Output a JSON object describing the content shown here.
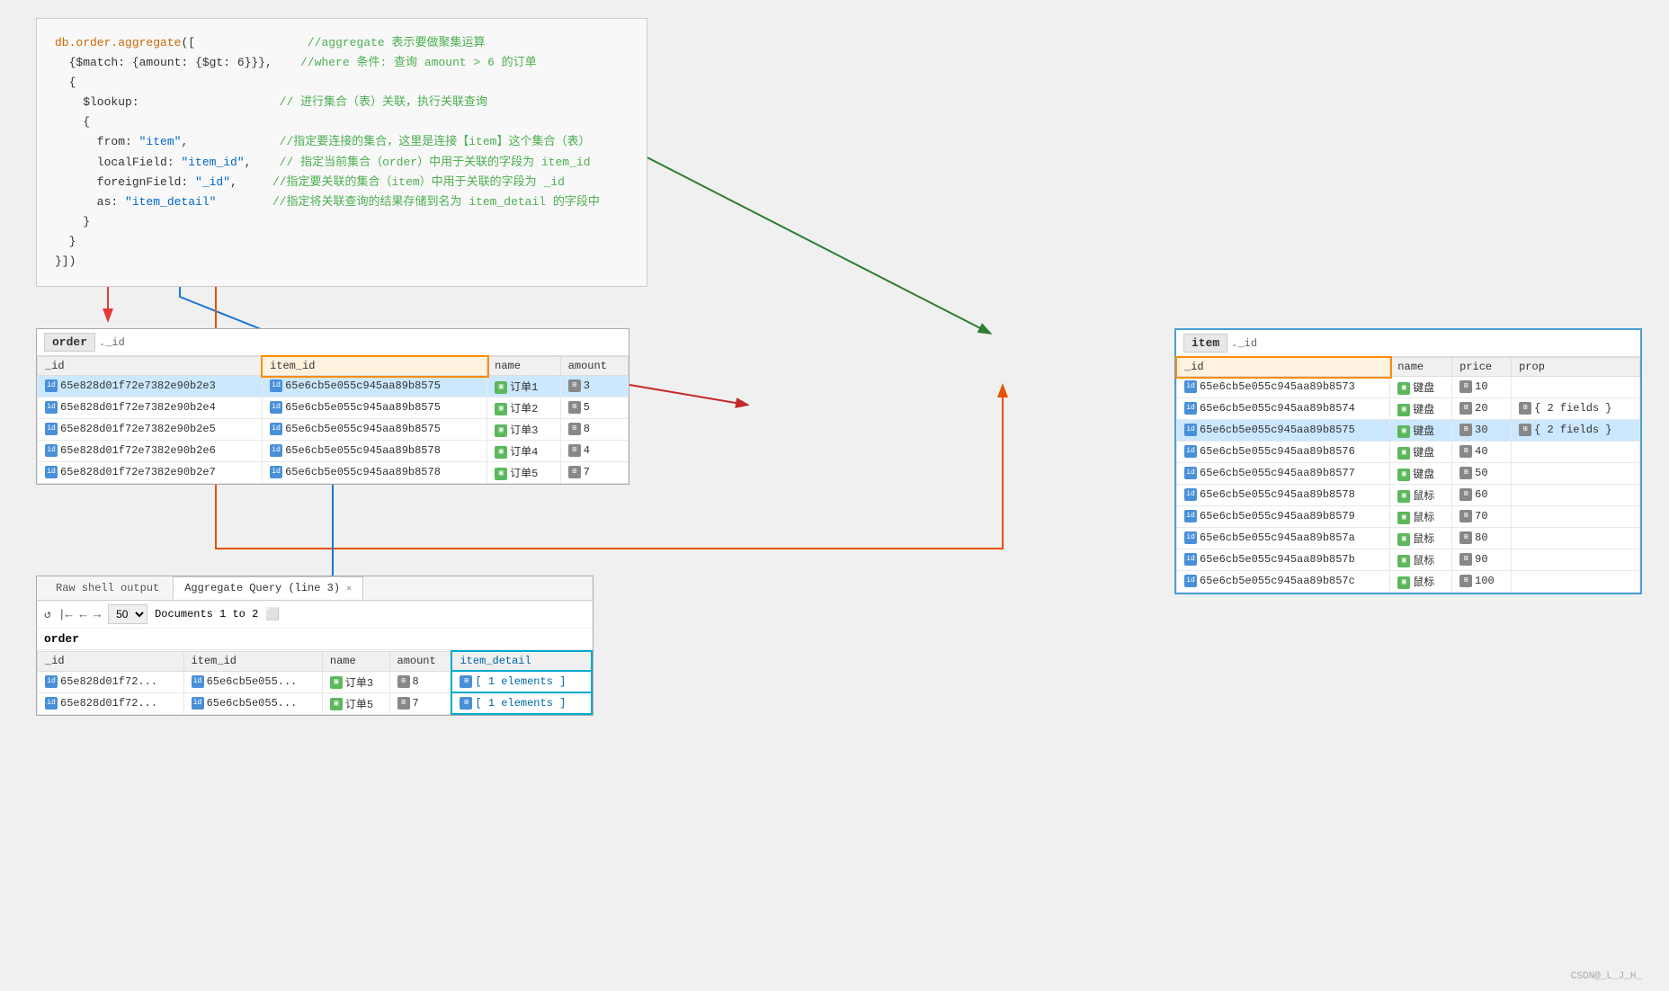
{
  "code": {
    "lines": [
      {
        "text": "db.order.aggregate([",
        "comment": ""
      },
      {
        "text": "  {$match: {amount: {$gt: 6}}},",
        "comment": "  //where 条件: 查询 amount > 6 的订单"
      },
      {
        "text": "  {",
        "comment": ""
      },
      {
        "text": "    $lookup:",
        "comment": "  // 进行集合（表）关联，执行关联查询"
      },
      {
        "text": "    {",
        "comment": ""
      },
      {
        "text": "      from: \"item\",",
        "comment": "      //指定要连接的集合，这里是连接【item】这个集合（表）"
      },
      {
        "text": "      localField: \"item_id\",",
        "comment": "      // 指定当前集合（order）中用于关联的字段为 item_id"
      },
      {
        "text": "      foreignField: \"_id\",",
        "comment": "      //指定要关联的集合（item）中用于关联的字段为 _id"
      },
      {
        "text": "      as: \"item_detail\"",
        "comment": "      //指定将关联查询的结果存储到名为 item_detail 的字段中"
      },
      {
        "text": "    }",
        "comment": ""
      },
      {
        "text": "  }",
        "comment": ""
      },
      {
        "text": "}])",
        "comment": ""
      }
    ]
  },
  "order_table": {
    "title": "order",
    "subtitle": "._id",
    "columns": [
      "_id",
      "item_id",
      "name",
      "amount"
    ],
    "rows": [
      {
        "id": "65e828d01f72e7382e90b2e3",
        "item_id": "65e6cb5e055c945aa89b8575",
        "name": "订单1",
        "amount": "3",
        "highlighted": true
      },
      {
        "id": "65e828d01f72e7382e90b2e4",
        "item_id": "65e6cb5e055c945aa89b8575",
        "name": "订单2",
        "amount": "5",
        "highlighted": false
      },
      {
        "id": "65e828d01f72e7382e90b2e5",
        "item_id": "65e6cb5e055c945aa89b8575",
        "name": "订单3",
        "amount": "8",
        "highlighted": false
      },
      {
        "id": "65e828d01f72e7382e90b2e6",
        "item_id": "65e6cb5e055c945aa89b8578",
        "name": "订单4",
        "amount": "4",
        "highlighted": false
      },
      {
        "id": "65e828d01f72e7382e90b2e7",
        "item_id": "65e6cb5e055c945aa89b8578",
        "name": "订单5",
        "amount": "7",
        "highlighted": false
      }
    ]
  },
  "item_table": {
    "title": "item",
    "subtitle": "._id",
    "columns": [
      "_id",
      "name",
      "price",
      "prop"
    ],
    "rows": [
      {
        "id": "65e6cb5e055c945aa89b8573",
        "name": "键盘",
        "price": "10",
        "prop": ""
      },
      {
        "id": "65e6cb5e055c945aa89b8574",
        "name": "键盘",
        "price": "20",
        "prop": "{ 2 fields }"
      },
      {
        "id": "65e6cb5e055c945aa89b8575",
        "name": "键盘",
        "price": "30",
        "prop": "{ 2 fields }",
        "highlighted": true
      },
      {
        "id": "65e6cb5e055c945aa89b8576",
        "name": "键盘",
        "price": "40",
        "prop": ""
      },
      {
        "id": "65e6cb5e055c945aa89b8577",
        "name": "键盘",
        "price": "50",
        "prop": ""
      },
      {
        "id": "65e6cb5e055c945aa89b8578",
        "name": "鼠标",
        "price": "60",
        "prop": ""
      },
      {
        "id": "65e6cb5e055c945aa89b8579",
        "name": "鼠标",
        "price": "70",
        "prop": ""
      },
      {
        "id": "65e6cb5e055c945aa89b857a",
        "name": "鼠标",
        "price": "80",
        "prop": ""
      },
      {
        "id": "65e6cb5e055c945aa89b857b",
        "name": "鼠标",
        "price": "90",
        "prop": ""
      },
      {
        "id": "65e6cb5e055c945aa89b857c",
        "name": "鼠标",
        "price": "100",
        "prop": ""
      }
    ]
  },
  "query_result": {
    "tabs": [
      "Raw shell output",
      "Aggregate Query (line 3)"
    ],
    "active_tab": "Aggregate Query (line 3)",
    "toolbar": {
      "page_size": "50",
      "page_info": "Documents 1 to 2"
    },
    "table_title": "order",
    "columns": [
      "_id",
      "item_id",
      "name",
      "amount",
      "item_detail"
    ],
    "rows": [
      {
        "id": "65e828d01f72...",
        "item_id": "65e6cb5e055...",
        "name": "订单3",
        "amount": "8",
        "item_detail": "[ 1 elements ]"
      },
      {
        "id": "65e828d01f72...",
        "item_id": "65e6cb5e055...",
        "name": "订单5",
        "amount": "7",
        "item_detail": "[ 1 elements ]"
      }
    ]
  },
  "item_label": "item",
  "watermark": "CSDN@_L_J_H_"
}
